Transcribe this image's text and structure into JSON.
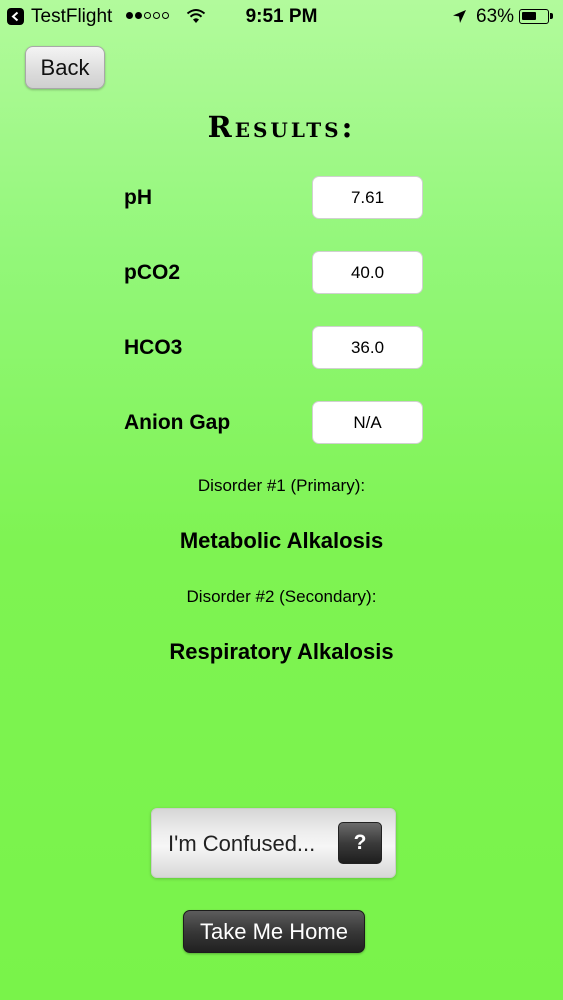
{
  "status_bar": {
    "back_app": "TestFlight",
    "signal_bars_filled": 2,
    "signal_bars_total": 5,
    "time": "9:51 PM",
    "battery_percent_text": "63%",
    "battery_level": 0.63
  },
  "nav": {
    "back_label": "Back"
  },
  "title": "Results:",
  "results": [
    {
      "label": "pH",
      "value": "7.61"
    },
    {
      "label": "pCO2",
      "value": "40.0"
    },
    {
      "label": "HCO3",
      "value": "36.0"
    },
    {
      "label": "Anion Gap",
      "value": "N/A"
    }
  ],
  "disorders": {
    "primary_caption": "Disorder #1 (Primary):",
    "primary_name": "Metabolic Alkalosis",
    "secondary_caption": "Disorder #2 (Secondary):",
    "secondary_name": "Respiratory Alkalosis"
  },
  "help": {
    "confused_label": "I'm Confused...",
    "help_icon_glyph": "?"
  },
  "home_label": "Take Me Home",
  "icons": {
    "back_app": "chevron-left-icon",
    "wifi": "wifi-icon",
    "location": "location-arrow-icon",
    "battery": "battery-icon",
    "help": "question-mark-icon"
  }
}
